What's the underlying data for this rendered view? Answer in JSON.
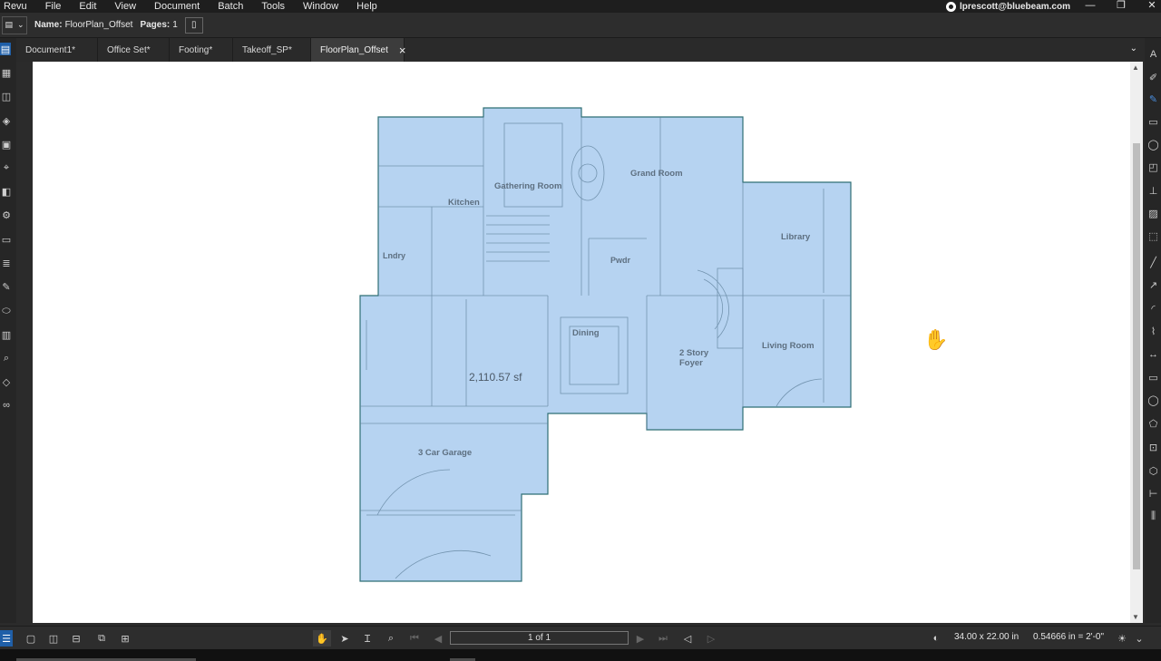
{
  "menubar": {
    "items": [
      "Revu",
      "File",
      "Edit",
      "View",
      "Document",
      "Batch",
      "Tools",
      "Window",
      "Help"
    ],
    "account": "lprescott@bluebeam.com"
  },
  "window_controls": {
    "minimize": "—",
    "restore": "❐",
    "close": "✕"
  },
  "properties": {
    "name_label": "Name:",
    "name_value": "FloorPlan_Offset",
    "pages_label": "Pages:",
    "pages_value": "1"
  },
  "tabs": [
    {
      "label": "Document1*",
      "active": false
    },
    {
      "label": "Office Set*",
      "active": false
    },
    {
      "label": "Footing*",
      "active": false
    },
    {
      "label": "Takeoff_SP*",
      "active": false
    },
    {
      "label": "FloorPlan_Offset",
      "active": true
    }
  ],
  "plan": {
    "rooms": {
      "kitchen": "Kitchen",
      "gathering": "Gathering Room",
      "grand": "Grand Room",
      "library": "Library",
      "laundry": "Lndry",
      "powder": "Pwdr",
      "dining": "Dining",
      "foyer_line1": "2 Story",
      "foyer_line2": "Foyer",
      "living": "Living Room",
      "garage": "3 Car Garage"
    },
    "area": "2,110.57 sf",
    "fill_color": "#9ec3ec",
    "stroke_color": "#2f6f75"
  },
  "statusbar": {
    "page": "1 of 1",
    "size": "34.00 x 22.00 in",
    "scale": "0.54666 in = 2'-0\""
  },
  "colors": {
    "accent": "#1f5fa8",
    "chrome": "#2d2d2d"
  }
}
